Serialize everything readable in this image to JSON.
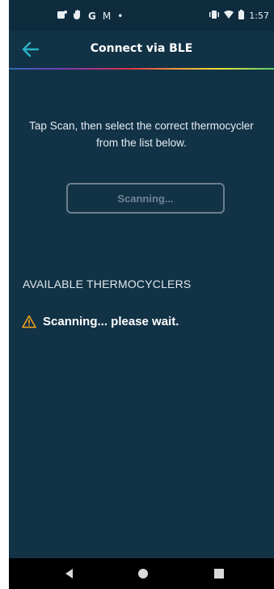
{
  "status_bar": {
    "time": "1:57",
    "left_icons": [
      "notification-icon",
      "hand-icon",
      "google-icon",
      "gmail-icon",
      "dot-icon"
    ],
    "right_icons": [
      "vibrate-icon",
      "wifi-icon",
      "battery-icon"
    ],
    "google_glyph": "G",
    "gmail_glyph": "M",
    "dot_glyph": "•"
  },
  "app_bar": {
    "title": "Connect via BLE",
    "back_icon": "arrow-left-icon"
  },
  "main": {
    "instruction": "Tap Scan, then select the correct thermocycler from the list below.",
    "scan_button_label": "Scanning...",
    "section_header": "AVAILABLE THERMOCYCLERS",
    "status_message": "Scanning... please wait."
  },
  "colors": {
    "background": "#123246",
    "accent": "#27b3c4",
    "warning": "#f2a21b"
  }
}
